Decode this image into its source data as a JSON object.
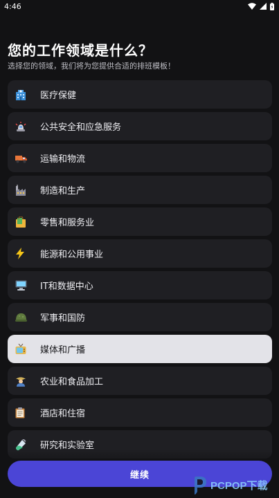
{
  "status_bar": {
    "time": "4:46"
  },
  "header": {
    "title": "您的工作领域是什么？",
    "subtitle": "选择您的领域，我们将为您提供合适的排班模板！"
  },
  "industries": [
    {
      "label": "医疗保健",
      "icon": "hospital-icon"
    },
    {
      "label": "公共安全和应急服务",
      "icon": "police-light-icon"
    },
    {
      "label": "运输和物流",
      "icon": "truck-icon"
    },
    {
      "label": "制造和生产",
      "icon": "factory-icon"
    },
    {
      "label": "零售和服务业",
      "icon": "shopping-bag-icon"
    },
    {
      "label": "能源和公用事业",
      "icon": "lightning-icon"
    },
    {
      "label": "IT和数据中心",
      "icon": "computer-icon"
    },
    {
      "label": "军事和国防",
      "icon": "military-helmet-icon"
    },
    {
      "label": "媒体和广播",
      "icon": "television-icon",
      "selected": true
    },
    {
      "label": "农业和食品加工",
      "icon": "farmer-icon"
    },
    {
      "label": "酒店和住宿",
      "icon": "clipboard-icon"
    },
    {
      "label": "研究和实验室",
      "icon": "test-tube-icon"
    }
  ],
  "footer": {
    "continue_label": "继续"
  },
  "watermark": {
    "text": "PCPOP下载"
  },
  "colors": {
    "background": "#121214",
    "item_background": "#1f1f23",
    "selected_background": "#e3e3e8",
    "accent": "#4b45d6"
  }
}
